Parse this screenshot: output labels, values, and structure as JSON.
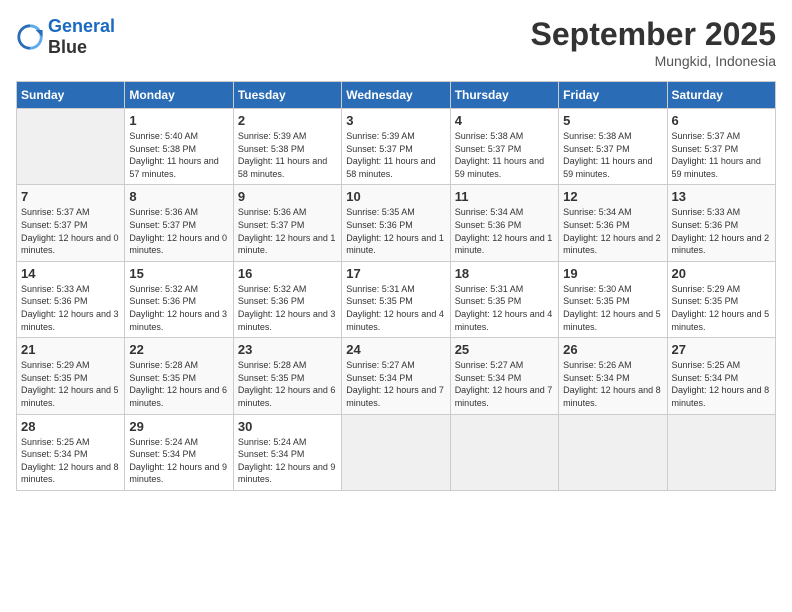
{
  "header": {
    "logo_line1": "General",
    "logo_line2": "Blue",
    "month": "September 2025",
    "location": "Mungkid, Indonesia"
  },
  "days_of_week": [
    "Sunday",
    "Monday",
    "Tuesday",
    "Wednesday",
    "Thursday",
    "Friday",
    "Saturday"
  ],
  "weeks": [
    [
      {
        "day": "",
        "sunrise": "",
        "sunset": "",
        "daylight": ""
      },
      {
        "day": "1",
        "sunrise": "Sunrise: 5:40 AM",
        "sunset": "Sunset: 5:38 PM",
        "daylight": "Daylight: 11 hours and 57 minutes."
      },
      {
        "day": "2",
        "sunrise": "Sunrise: 5:39 AM",
        "sunset": "Sunset: 5:38 PM",
        "daylight": "Daylight: 11 hours and 58 minutes."
      },
      {
        "day": "3",
        "sunrise": "Sunrise: 5:39 AM",
        "sunset": "Sunset: 5:37 PM",
        "daylight": "Daylight: 11 hours and 58 minutes."
      },
      {
        "day": "4",
        "sunrise": "Sunrise: 5:38 AM",
        "sunset": "Sunset: 5:37 PM",
        "daylight": "Daylight: 11 hours and 59 minutes."
      },
      {
        "day": "5",
        "sunrise": "Sunrise: 5:38 AM",
        "sunset": "Sunset: 5:37 PM",
        "daylight": "Daylight: 11 hours and 59 minutes."
      },
      {
        "day": "6",
        "sunrise": "Sunrise: 5:37 AM",
        "sunset": "Sunset: 5:37 PM",
        "daylight": "Daylight: 11 hours and 59 minutes."
      }
    ],
    [
      {
        "day": "7",
        "sunrise": "Sunrise: 5:37 AM",
        "sunset": "Sunset: 5:37 PM",
        "daylight": "Daylight: 12 hours and 0 minutes."
      },
      {
        "day": "8",
        "sunrise": "Sunrise: 5:36 AM",
        "sunset": "Sunset: 5:37 PM",
        "daylight": "Daylight: 12 hours and 0 minutes."
      },
      {
        "day": "9",
        "sunrise": "Sunrise: 5:36 AM",
        "sunset": "Sunset: 5:37 PM",
        "daylight": "Daylight: 12 hours and 1 minute."
      },
      {
        "day": "10",
        "sunrise": "Sunrise: 5:35 AM",
        "sunset": "Sunset: 5:36 PM",
        "daylight": "Daylight: 12 hours and 1 minute."
      },
      {
        "day": "11",
        "sunrise": "Sunrise: 5:34 AM",
        "sunset": "Sunset: 5:36 PM",
        "daylight": "Daylight: 12 hours and 1 minute."
      },
      {
        "day": "12",
        "sunrise": "Sunrise: 5:34 AM",
        "sunset": "Sunset: 5:36 PM",
        "daylight": "Daylight: 12 hours and 2 minutes."
      },
      {
        "day": "13",
        "sunrise": "Sunrise: 5:33 AM",
        "sunset": "Sunset: 5:36 PM",
        "daylight": "Daylight: 12 hours and 2 minutes."
      }
    ],
    [
      {
        "day": "14",
        "sunrise": "Sunrise: 5:33 AM",
        "sunset": "Sunset: 5:36 PM",
        "daylight": "Daylight: 12 hours and 3 minutes."
      },
      {
        "day": "15",
        "sunrise": "Sunrise: 5:32 AM",
        "sunset": "Sunset: 5:36 PM",
        "daylight": "Daylight: 12 hours and 3 minutes."
      },
      {
        "day": "16",
        "sunrise": "Sunrise: 5:32 AM",
        "sunset": "Sunset: 5:36 PM",
        "daylight": "Daylight: 12 hours and 3 minutes."
      },
      {
        "day": "17",
        "sunrise": "Sunrise: 5:31 AM",
        "sunset": "Sunset: 5:35 PM",
        "daylight": "Daylight: 12 hours and 4 minutes."
      },
      {
        "day": "18",
        "sunrise": "Sunrise: 5:31 AM",
        "sunset": "Sunset: 5:35 PM",
        "daylight": "Daylight: 12 hours and 4 minutes."
      },
      {
        "day": "19",
        "sunrise": "Sunrise: 5:30 AM",
        "sunset": "Sunset: 5:35 PM",
        "daylight": "Daylight: 12 hours and 5 minutes."
      },
      {
        "day": "20",
        "sunrise": "Sunrise: 5:29 AM",
        "sunset": "Sunset: 5:35 PM",
        "daylight": "Daylight: 12 hours and 5 minutes."
      }
    ],
    [
      {
        "day": "21",
        "sunrise": "Sunrise: 5:29 AM",
        "sunset": "Sunset: 5:35 PM",
        "daylight": "Daylight: 12 hours and 5 minutes."
      },
      {
        "day": "22",
        "sunrise": "Sunrise: 5:28 AM",
        "sunset": "Sunset: 5:35 PM",
        "daylight": "Daylight: 12 hours and 6 minutes."
      },
      {
        "day": "23",
        "sunrise": "Sunrise: 5:28 AM",
        "sunset": "Sunset: 5:35 PM",
        "daylight": "Daylight: 12 hours and 6 minutes."
      },
      {
        "day": "24",
        "sunrise": "Sunrise: 5:27 AM",
        "sunset": "Sunset: 5:34 PM",
        "daylight": "Daylight: 12 hours and 7 minutes."
      },
      {
        "day": "25",
        "sunrise": "Sunrise: 5:27 AM",
        "sunset": "Sunset: 5:34 PM",
        "daylight": "Daylight: 12 hours and 7 minutes."
      },
      {
        "day": "26",
        "sunrise": "Sunrise: 5:26 AM",
        "sunset": "Sunset: 5:34 PM",
        "daylight": "Daylight: 12 hours and 8 minutes."
      },
      {
        "day": "27",
        "sunrise": "Sunrise: 5:25 AM",
        "sunset": "Sunset: 5:34 PM",
        "daylight": "Daylight: 12 hours and 8 minutes."
      }
    ],
    [
      {
        "day": "28",
        "sunrise": "Sunrise: 5:25 AM",
        "sunset": "Sunset: 5:34 PM",
        "daylight": "Daylight: 12 hours and 8 minutes."
      },
      {
        "day": "29",
        "sunrise": "Sunrise: 5:24 AM",
        "sunset": "Sunset: 5:34 PM",
        "daylight": "Daylight: 12 hours and 9 minutes."
      },
      {
        "day": "30",
        "sunrise": "Sunrise: 5:24 AM",
        "sunset": "Sunset: 5:34 PM",
        "daylight": "Daylight: 12 hours and 9 minutes."
      },
      {
        "day": "",
        "sunrise": "",
        "sunset": "",
        "daylight": ""
      },
      {
        "day": "",
        "sunrise": "",
        "sunset": "",
        "daylight": ""
      },
      {
        "day": "",
        "sunrise": "",
        "sunset": "",
        "daylight": ""
      },
      {
        "day": "",
        "sunrise": "",
        "sunset": "",
        "daylight": ""
      }
    ]
  ]
}
